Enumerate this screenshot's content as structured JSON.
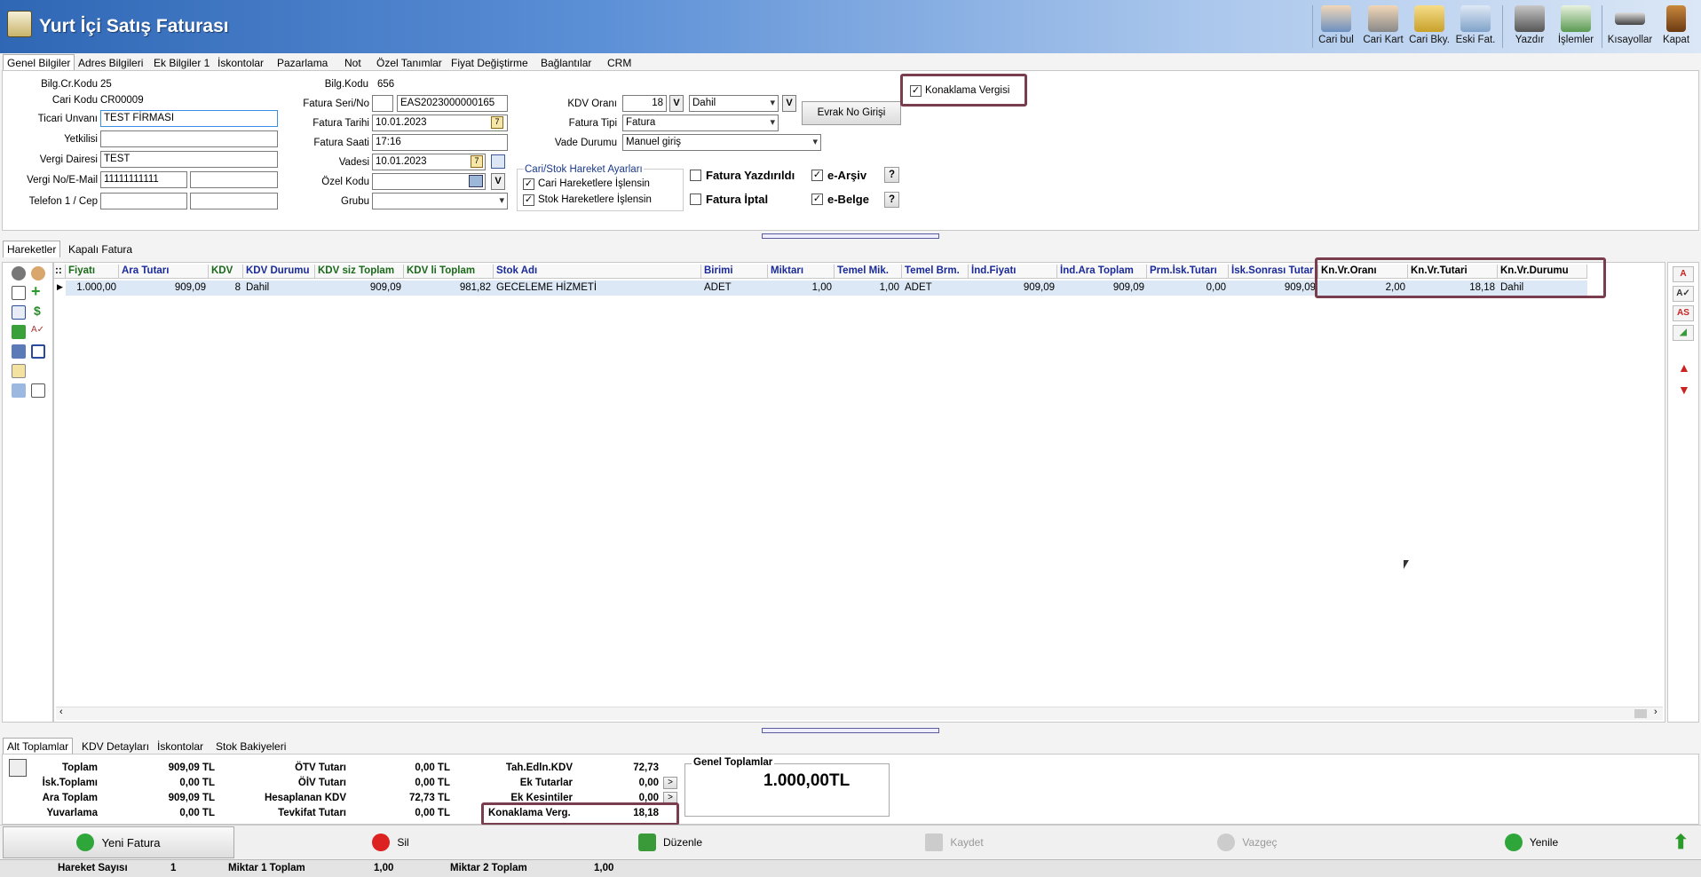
{
  "window": {
    "title": "Yurt İçi Satış Faturası"
  },
  "toolbar": [
    {
      "label": "Cari bul",
      "icon": "search-person-icon"
    },
    {
      "label": "Cari Kart",
      "icon": "customer-card-icon"
    },
    {
      "label": "Cari Bky.",
      "icon": "customer-balance-icon"
    },
    {
      "label": "Eski Fat.",
      "icon": "old-invoices-icon"
    },
    {
      "label": "Yazdır",
      "icon": "printer-icon"
    },
    {
      "label": "İşlemler",
      "icon": "operations-icon"
    },
    {
      "label": "Kısayollar",
      "icon": "keyboard-icon"
    },
    {
      "label": "Kapat",
      "icon": "exit-door-icon"
    }
  ],
  "main_tabs": [
    "Genel Bilgiler",
    "Adres Bilgileri",
    "Ek Bilgiler 1",
    "İskontolar",
    "Pazarlama",
    "Not",
    "Özel Tanımlar",
    "Fiyat Değiştirme",
    "Bağlantılar",
    "CRM"
  ],
  "form": {
    "bilg_cr_kodu_label": "Bilg.Cr.Kodu",
    "bilg_cr_kodu": "25",
    "cari_kodu_label": "Cari Kodu",
    "cari_kodu": "CR00009",
    "ticari_unvan_label": "Ticari Unvanı",
    "ticari_unvan": "TEST FİRMASI",
    "yetkili_label": "Yetkilisi",
    "yetkili": "",
    "vergi_dairesi_label": "Vergi Dairesi",
    "vergi_dairesi": "TEST",
    "vergi_no_label": "Vergi No/E-Mail",
    "vergi_no": "11111111111",
    "email": "",
    "telefon_label": "Telefon 1 / Cep",
    "telefon": "",
    "cep": "",
    "bilg_kodu_label": "Bilg.Kodu",
    "bilg_kodu": "656",
    "fatura_seri_label": "Fatura Seri/No",
    "fatura_seri": "",
    "fatura_no": "EAS2023000000165",
    "fatura_tarihi_label": "Fatura Tarihi",
    "fatura_tarihi": "10.01.2023",
    "fatura_saati_label": "Fatura Saati",
    "fatura_saati": "17:16",
    "vadesi_label": "Vadesi",
    "vadesi": "10.01.2023",
    "ozel_kodu_label": "Özel Kodu",
    "ozel_kodu": "",
    "grubu_label": "Grubu",
    "grubu": "",
    "kdv_orani_label": "KDV Oranı",
    "kdv_orani": "18",
    "kdv_durum": "Dahil",
    "fatura_tipi_label": "Fatura Tipi",
    "fatura_tipi": "Fatura",
    "vade_durumu_label": "Vade Durumu",
    "vade_durumu": "Manuel giriş",
    "evrak_no_button": "Evrak No Girişi",
    "konaklama_vergisi": "Konaklama Vergisi",
    "hareket_ayarlari_title": "Cari/Stok Hareket Ayarları",
    "cari_hareket": "Cari Hareketlere İşlensin",
    "stok_hareket": "Stok Hareketlere İşlensin",
    "fatura_yazdirildi": "Fatura Yazdırıldı",
    "fatura_iptal": "Fatura İptal",
    "e_arsiv": "e-Arşiv",
    "e_belge": "e-Belge",
    "v_label": "V",
    "help_label": "?"
  },
  "grid_tabs": [
    "Hareketler",
    "Kapalı Fatura"
  ],
  "grid": {
    "columns": [
      "Fiyatı",
      "Ara Tutarı",
      "KDV",
      "KDV Durumu",
      "KDV siz Toplam",
      "KDV li Toplam",
      "Stok Adı",
      "Birimi",
      "Miktarı",
      "Temel Mik.",
      "Temel Brm.",
      "İnd.Fiyatı",
      "İnd.Ara Toplam",
      "Prm.İsk.Tutarı",
      "İsk.Sonrası Tutar",
      "Kn.Vr.Oranı",
      "Kn.Vr.Tutari",
      "Kn.Vr.Durumu"
    ],
    "rows": [
      [
        "1.000,00",
        "909,09",
        "8",
        "Dahil",
        "909,09",
        "981,82",
        "GECELEME HİZMETİ",
        "ADET",
        "1,00",
        "1,00",
        "ADET",
        "909,09",
        "909,09",
        "0,00",
        "909,09",
        "2,00",
        "18,18",
        "Dahil"
      ]
    ]
  },
  "bottom_tabs": [
    "Alt Toplamlar",
    "KDV Detayları",
    "İskontolar",
    "Stok Bakiyeleri"
  ],
  "totals": {
    "toplam_label": "Toplam",
    "toplam": "909,09 TL",
    "isk_toplami_label": "İsk.Toplamı",
    "isk_toplami": "0,00 TL",
    "ara_toplam_label": "Ara Toplam",
    "ara_toplam": "909,09 TL",
    "yuvarlama_label": "Yuvarlama",
    "yuvarlama": "0,00 TL",
    "otv_label": "ÖTV Tutarı",
    "otv": "0,00 TL",
    "oiv_label": "ÖİV Tutarı",
    "oiv": "0,00 TL",
    "hesaplanan_kdv_label": "Hesaplanan KDV",
    "hesaplanan_kdv": "72,73 TL",
    "tevkifat_label": "Tevkifat Tutarı",
    "tevkifat": "0,00 TL",
    "tah_edln_kdv_label": "Tah.Edln.KDV",
    "tah_edln_kdv": "72,73",
    "ek_tutarlar_label": "Ek Tutarlar",
    "ek_tutarlar": "0,00",
    "ek_kesintiler_label": "Ek Kesintiler",
    "ek_kesintiler": "0,00",
    "konaklama_label": "Konaklama Verg.",
    "konaklama": "18,18",
    "genel_toplamlar_label": "Genel Toplamlar",
    "genel_toplam": "1.000,00TL",
    "arrow": ">"
  },
  "actions": {
    "yeni_fatura": "Yeni Fatura",
    "sil": "Sil",
    "duzenle": "Düzenle",
    "kaydet": "Kaydet",
    "vazgec": "Vazgeç",
    "yenile": "Yenile"
  },
  "status": {
    "hareket_sayisi_label": "Hareket Sayısı",
    "hareket_sayisi": "1",
    "miktar1_label": "Miktar 1 Toplam",
    "miktar1": "1,00",
    "miktar2_label": "Miktar 2 Toplam",
    "miktar2": "1,00"
  },
  "colors": {
    "highlight_box": "#7a3d4e",
    "title_gradient_start": "#2f67b5",
    "selected_row": "#dce8f5"
  }
}
